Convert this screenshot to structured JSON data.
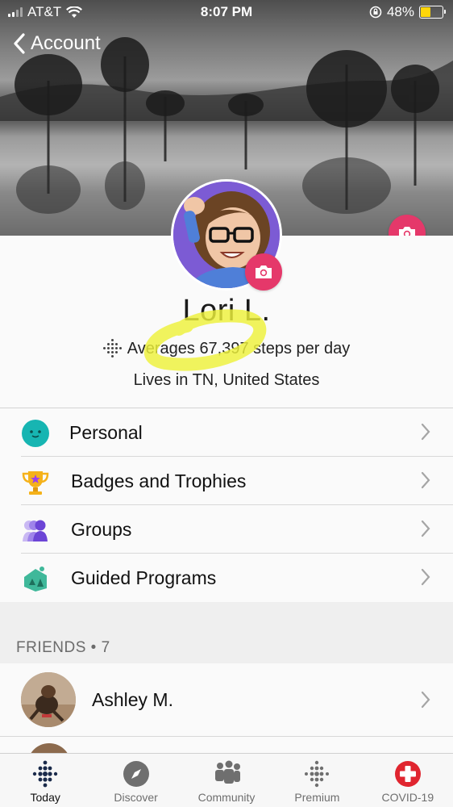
{
  "status_bar": {
    "carrier": "AT&T",
    "time": "8:07 PM",
    "battery_percent": "48%",
    "battery_level": 0.48,
    "battery_color": "#ffd60a"
  },
  "header": {
    "back_label": "Account"
  },
  "profile": {
    "name": "Lori L.",
    "steps_text": "Averages 67,397 steps per day",
    "location_text": "Lives in TN, United States"
  },
  "menu": {
    "items": [
      {
        "label": "Personal",
        "icon": "personal-face-icon"
      },
      {
        "label": "Badges and Trophies",
        "icon": "trophy-icon"
      },
      {
        "label": "Groups",
        "icon": "groups-icon"
      },
      {
        "label": "Guided Programs",
        "icon": "guided-programs-icon"
      }
    ]
  },
  "friends": {
    "header": "FRIENDS • 7",
    "items": [
      {
        "name": "Ashley M."
      }
    ]
  },
  "tabbar": {
    "tabs": [
      {
        "label": "Today",
        "icon": "fitbit-dots-icon",
        "active": true
      },
      {
        "label": "Discover",
        "icon": "compass-icon",
        "active": false
      },
      {
        "label": "Community",
        "icon": "community-icon",
        "active": false
      },
      {
        "label": "Premium",
        "icon": "premium-dots-icon",
        "active": false
      },
      {
        "label": "COVID-19",
        "icon": "medical-cross-icon",
        "active": false
      }
    ]
  },
  "colors": {
    "accent_pink": "#e5386a",
    "highlight_yellow": "#eef23a",
    "covid_red": "#e0252f"
  }
}
